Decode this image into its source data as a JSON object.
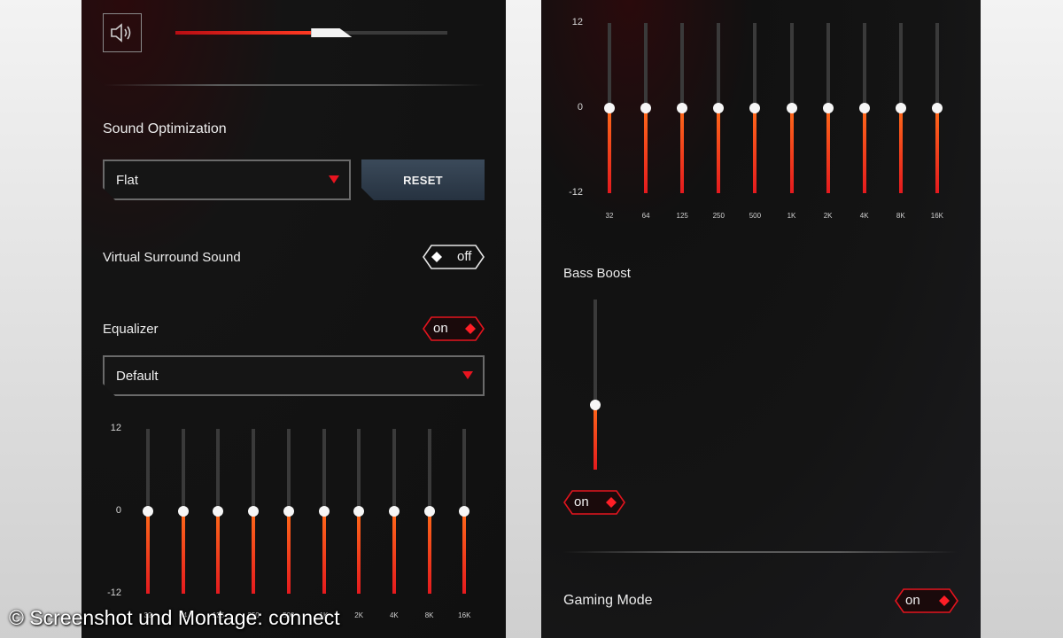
{
  "left": {
    "volume": {
      "level": 0.61
    },
    "sound_optimization": {
      "label": "Sound Optimization",
      "selected": "Flat",
      "reset_label": "RESET"
    },
    "virtual_surround": {
      "label": "Virtual Surround Sound",
      "state": "off"
    },
    "equalizer": {
      "label": "Equalizer",
      "state": "on",
      "preset": "Default",
      "scale": [
        "12",
        "0",
        "-12"
      ],
      "bands": [
        "32",
        "64",
        "125",
        "250",
        "500",
        "1K",
        "2K",
        "4K",
        "8K",
        "16K"
      ],
      "values_db": [
        0,
        0,
        0,
        0,
        0,
        0,
        0,
        0,
        0,
        0
      ]
    }
  },
  "right": {
    "equalizer": {
      "scale": [
        "12",
        "0",
        "-12"
      ],
      "bands": [
        "32",
        "64",
        "125",
        "250",
        "500",
        "1K",
        "2K",
        "4K",
        "8K",
        "16K"
      ],
      "values_db": [
        0,
        0,
        0,
        0,
        0,
        0,
        0,
        0,
        0,
        0
      ]
    },
    "bass_boost": {
      "label": "Bass Boost",
      "level": 0.38,
      "state": "on"
    },
    "gaming_mode": {
      "label": "Gaming Mode",
      "state": "on"
    }
  },
  "watermark": "© Screenshot und Montage: connect",
  "colors": {
    "accent_red": "#e8141f",
    "panel_bg": "#141414",
    "reset_bg": "#2e3b4a"
  },
  "icons": {
    "volume": "speaker-icon",
    "dropdown": "triangle-down-icon",
    "toggle_knob": "diamond-icon"
  }
}
